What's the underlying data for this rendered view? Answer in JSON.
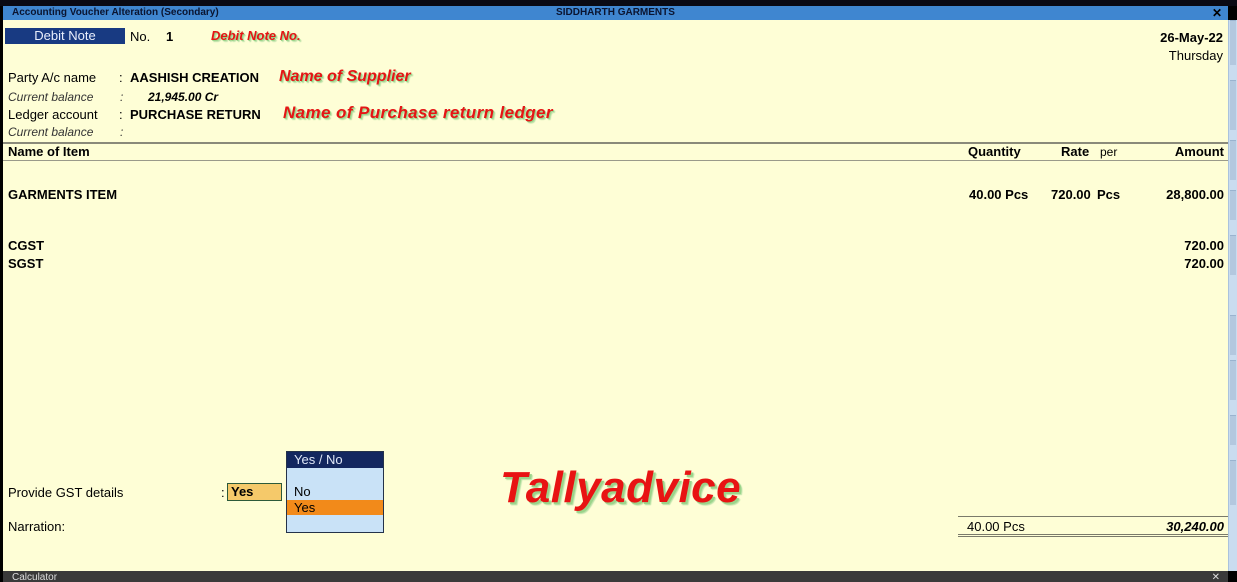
{
  "window": {
    "title_left": "Accounting Voucher Alteration (Secondary)",
    "title_center": "SIDDHARTH GARMENTS",
    "close_glyph": "✕"
  },
  "voucher": {
    "type_label": "Debit Note",
    "no_label": "No.",
    "no_value": "1",
    "date": "26-May-22",
    "day": "Thursday"
  },
  "annotations": {
    "voucher_no": "Debit Note No.",
    "supplier": "Name of Supplier",
    "ledger": "Name of Purchase return ledger",
    "watermark": "Tallyadvice"
  },
  "party": {
    "label": "Party A/c name",
    "colon": ":",
    "value": "AASHISH CREATION",
    "balance_label": "Current balance",
    "balance_value": "21,945.00 Cr"
  },
  "ledger": {
    "label": "Ledger account",
    "colon": ":",
    "value": "PURCHASE RETURN",
    "balance_label": "Current balance",
    "balance_value": ""
  },
  "table": {
    "headers": {
      "item": "Name of Item",
      "quantity": "Quantity",
      "rate": "Rate",
      "per": "per",
      "amount": "Amount"
    },
    "items": [
      {
        "name": "GARMENTS ITEM",
        "quantity": "40.00 Pcs",
        "rate": "720.00",
        "per": "Pcs",
        "amount": "28,800.00"
      }
    ],
    "taxes": [
      {
        "name": "CGST",
        "amount": "720.00"
      },
      {
        "name": "SGST",
        "amount": "720.00"
      }
    ]
  },
  "gst": {
    "label": "Provide GST details",
    "colon": ":",
    "value": "Yes"
  },
  "popup": {
    "title": "Yes / No",
    "options": [
      "No",
      "Yes"
    ],
    "selected": "Yes"
  },
  "narration": {
    "label": "Narration:",
    "value": ""
  },
  "totals": {
    "quantity": "40.00 Pcs",
    "amount": "30,240.00"
  },
  "bottom_bar": {
    "label": "Calculator",
    "close_glyph": "✕"
  },
  "colors": {
    "screen_bg": "#fefed6",
    "titlebar": "#3f86d0",
    "voucher_type_bg": "#183a82",
    "field_highlight": "#f5c96a",
    "popup_bg": "#c9e2f7",
    "popup_selected": "#f28a1a",
    "annotation_red": "#e51515"
  }
}
